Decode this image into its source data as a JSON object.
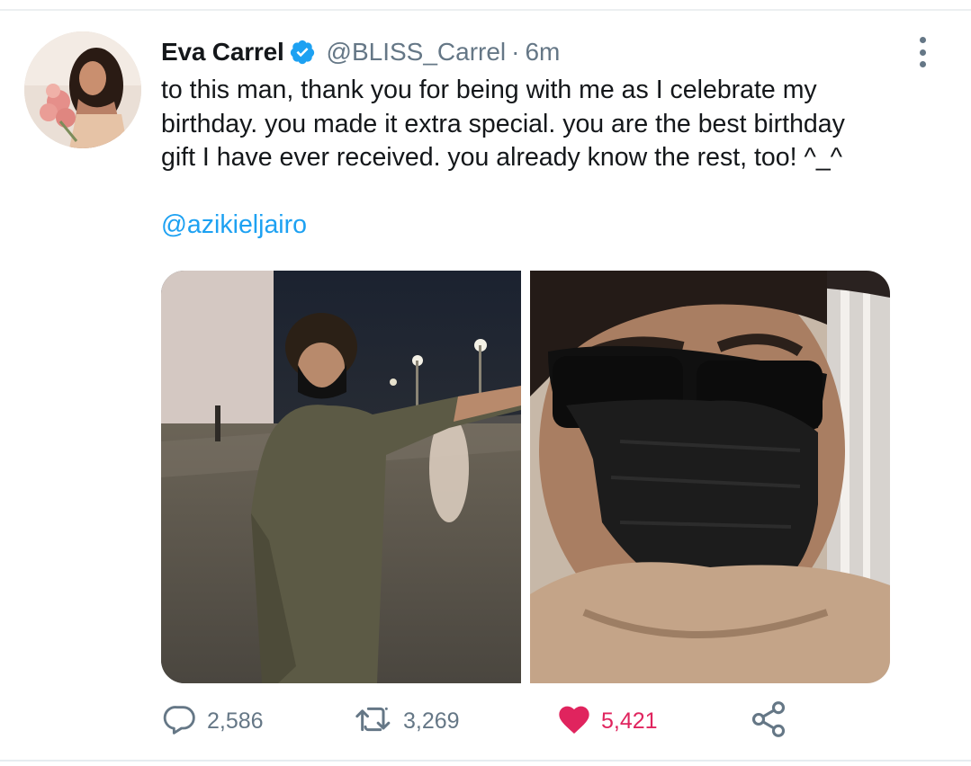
{
  "tweet": {
    "author_name": "Eva Carrel",
    "author_handle": "@BLISS_Carrel",
    "separator": "·",
    "timestamp": "6m",
    "verified": true,
    "text_lines": [
      "to this man, thank you for being with me as I celebrate my",
      "birthday. you made it extra special. you are the best birthday",
      "gift I have ever received. you already know the rest, too! ^_^"
    ],
    "mention": "@azikieljairo",
    "media_count": 2
  },
  "actions": {
    "reply_count": "2,586",
    "retweet_count": "3,269",
    "like_count": "5,421",
    "liked": true
  },
  "icons": {
    "verified": "verified-badge-icon",
    "more": "more-vertical-icon",
    "reply": "reply-icon",
    "retweet": "retweet-icon",
    "like": "heart-icon",
    "share": "share-icon"
  },
  "colors": {
    "accent": "#1da1f2",
    "like": "#e0245e",
    "muted": "#657786",
    "text": "#14171a"
  }
}
